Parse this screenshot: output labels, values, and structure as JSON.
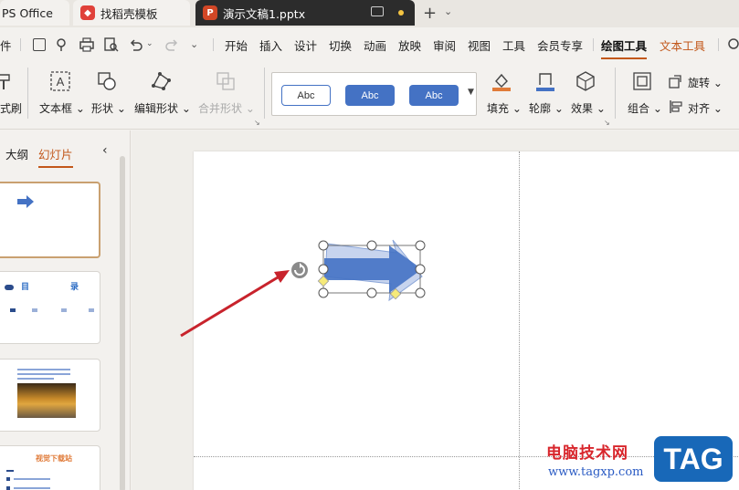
{
  "tabs": {
    "wps": "PS Office",
    "daoke": "找稻壳模板",
    "doc": "演示文稿1.pptx"
  },
  "menu": {
    "file": "件",
    "items": [
      "开始",
      "插入",
      "设计",
      "切换",
      "动画",
      "放映",
      "审阅",
      "视图",
      "工具",
      "会员专享"
    ],
    "drawing_tools": "绘图工具",
    "text_tools": "文本工具"
  },
  "ribbon": {
    "format_painter": "式刷",
    "textbox": "文本框",
    "shape": "形状",
    "edit_shape": "编辑形状",
    "merge_shape": "合并形状",
    "style_labels": [
      "Abc",
      "Abc",
      "Abc"
    ],
    "fill": "填充",
    "outline": "轮廓",
    "effect": "效果",
    "rotate": "旋转",
    "group": "组合",
    "align": "对齐"
  },
  "left_panel": {
    "outline_tab": "大纲",
    "slides_tab": "幻灯片",
    "thumb2_title_left": "目",
    "thumb2_title_right": "录",
    "thumb4_title": "视觉下载站"
  },
  "colors": {
    "accent": "#c2571a",
    "shape_blue": "#4472c4",
    "arrow_red": "#c8232c"
  },
  "watermark": {
    "title": "电脑技术网",
    "url": "www.tagxp.com",
    "badge": "TAG"
  }
}
